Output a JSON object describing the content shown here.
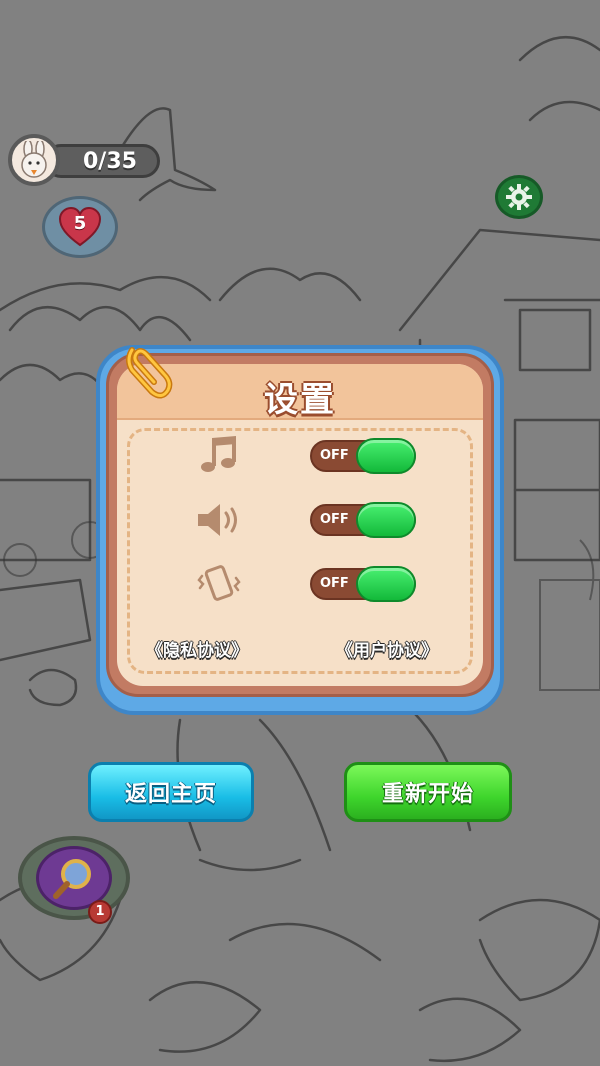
{
  "hud": {
    "rabbit_counter": "0/35",
    "hearts": "5",
    "hint_count": "1"
  },
  "settings": {
    "title": "设置",
    "rows": [
      {
        "icon": "music-note-icon",
        "toggle_label": "OFF"
      },
      {
        "icon": "speaker-icon",
        "toggle_label": "OFF"
      },
      {
        "icon": "vibration-icon",
        "toggle_label": "OFF"
      }
    ],
    "privacy_link": "《隐私协议》",
    "user_link": "《用户协议》"
  },
  "buttons": {
    "home": "返回主页",
    "restart": "重新开始"
  },
  "colors": {
    "panel_blue": "#5ea9e6",
    "panel_cream": "#f6e0c8",
    "toggle_green": "#2ed552",
    "home_button": "#19bde6",
    "restart_button": "#3ed52c"
  }
}
